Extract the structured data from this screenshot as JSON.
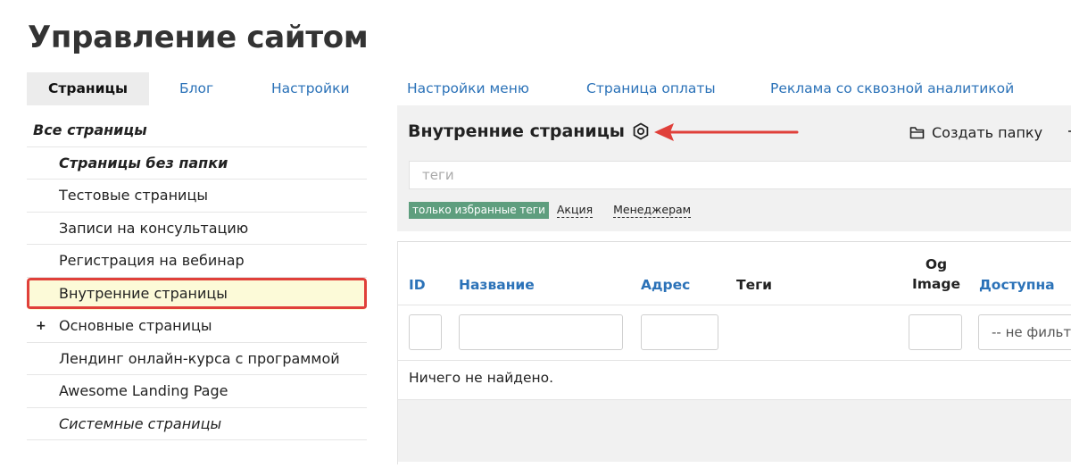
{
  "page_title": "Управление сайтом",
  "tabs": [
    {
      "label": "Страницы",
      "active": true
    },
    {
      "label": "Блог"
    },
    {
      "label": "Настройки"
    },
    {
      "label": "Настройки меню"
    },
    {
      "label": "Страница оплаты"
    },
    {
      "label": "Реклама со сквозной аналитикой"
    }
  ],
  "sidebar": {
    "items": [
      {
        "label": "Все страницы"
      },
      {
        "label": "Страницы без папки"
      },
      {
        "label": "Тестовые страницы"
      },
      {
        "label": "Записи на консультацию"
      },
      {
        "label": "Регистрация на вебинар"
      },
      {
        "label": "Внутренние страницы",
        "selected": true
      },
      {
        "label": "Основные страницы",
        "expand_glyph": "+"
      },
      {
        "label": "Лендинг онлайн-курса с программой"
      },
      {
        "label": "Awesome Landing Page"
      },
      {
        "label": "Системные страницы"
      }
    ]
  },
  "folder": {
    "title": "Внутренние страницы",
    "settings_icon": "settings-hex-icon",
    "create_folder_label": "Создать папку"
  },
  "tags": {
    "placeholder": "теги",
    "favorite_label": "только избранные теги",
    "items": [
      "Акция",
      "Менеджерам"
    ]
  },
  "table": {
    "columns": {
      "id": "ID",
      "name": "Название",
      "address": "Адрес",
      "tags": "Теги",
      "og_line1": "Og",
      "og_line2": "Image",
      "available": "Доступна"
    },
    "filter_select_value": "-- не фильтр",
    "empty_message": "Ничего не найдено."
  },
  "colors": {
    "link": "#2b72b8",
    "favorite_tag_bg": "#5e9e7e",
    "highlight_border": "#e0403a",
    "highlight_bg": "#fcfad8",
    "arrow": "#e0403a"
  }
}
